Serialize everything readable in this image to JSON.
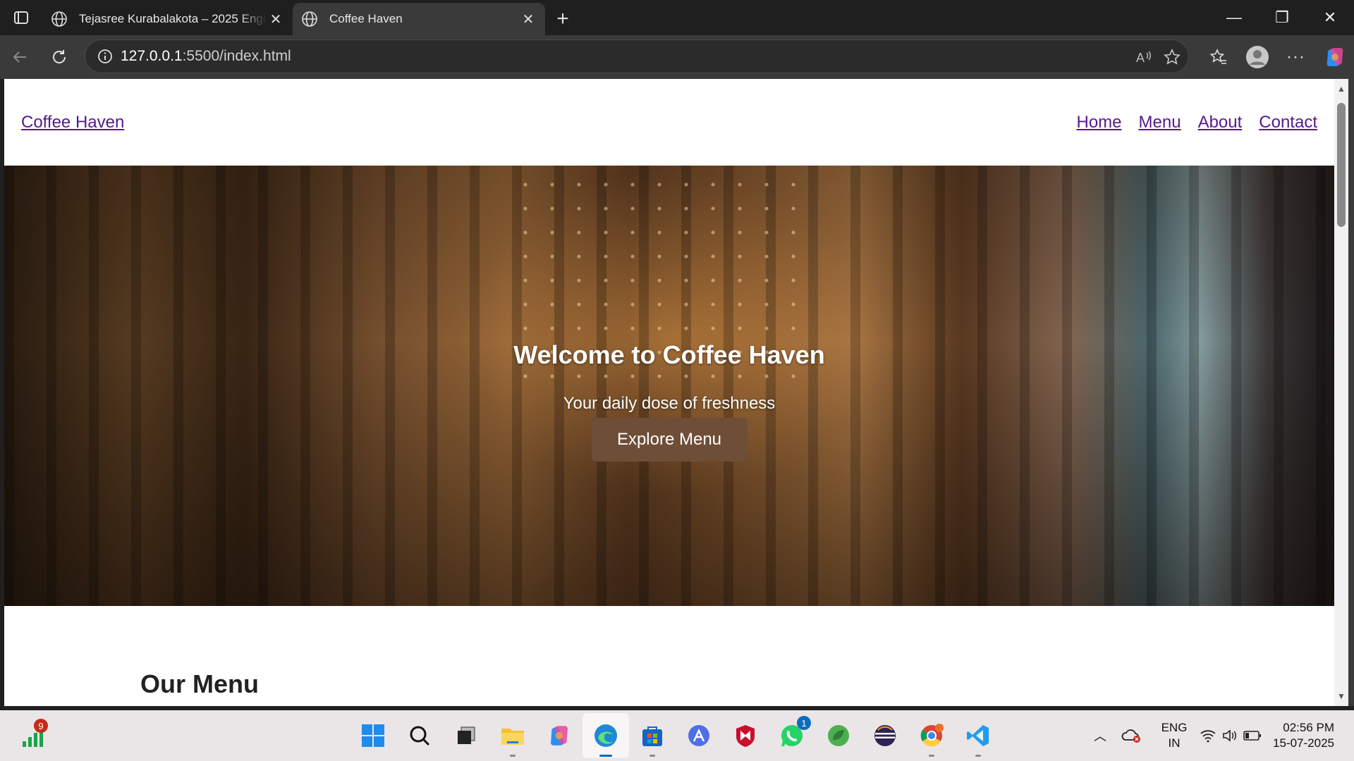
{
  "browser": {
    "tabs": [
      {
        "title": "Tejasree Kurabalakota – 2025 Engi",
        "active": false
      },
      {
        "title": "Coffee Haven",
        "active": true
      }
    ],
    "address": {
      "host": "127.0.0.1",
      "rest": ":5500/index.html"
    }
  },
  "site": {
    "logo": "Coffee Haven",
    "nav": [
      "Home",
      "Menu",
      "About",
      "Contact"
    ],
    "hero": {
      "title": "Welcome to Coffee Haven",
      "subtitle": "Your daily dose of freshness",
      "button": "Explore Menu"
    },
    "menu_heading": "Our Menu"
  },
  "taskbar": {
    "signal_badge": "9",
    "whatsapp_badge": "1",
    "lang_1": "ENG",
    "lang_2": "IN",
    "time": "02:56 PM",
    "date": "15-07-2025"
  },
  "colors": {
    "accent_button": "#6f4e37",
    "link": "#551a8b",
    "browser_dark": "#1f1f1f",
    "taskbar": "#eae5e7"
  }
}
